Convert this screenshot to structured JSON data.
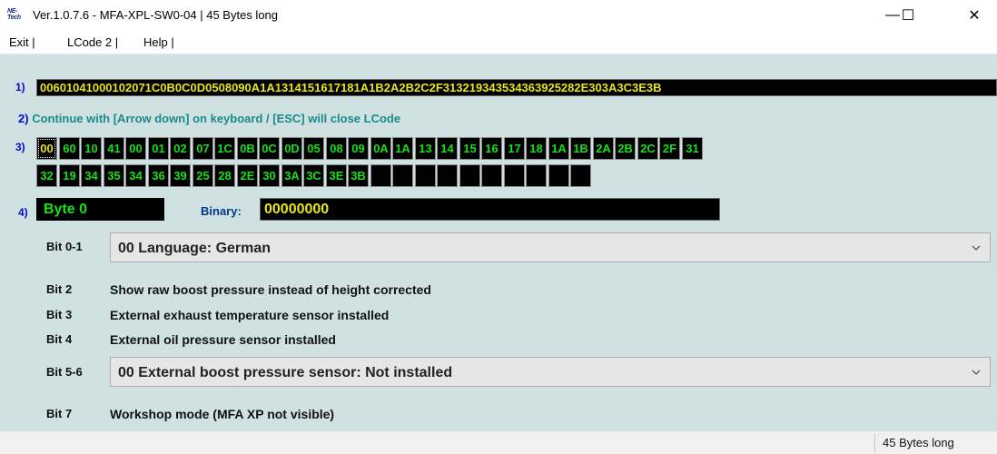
{
  "window": {
    "icon_text": [
      "NE-",
      "Tech"
    ],
    "title": "Ver.1.0.7.6 -   MFA-XPL-SW0-04 | 45 Bytes long",
    "minimize": "—",
    "maximize": "☐",
    "close": "✕"
  },
  "menu": [
    "Exit |",
    "LCode 2 |",
    "Help |"
  ],
  "section_numbers": [
    "1)",
    "2)",
    "3)",
    "4)"
  ],
  "code_string": "00601041000102071C0B0C0D0508090A1A1314151617181A1B2A2B2C2F313219343534363925282E303A3C3E3B",
  "hint": "Continue with [Arrow down] on keyboard / [ESC] will close LCode",
  "bytes_row1": [
    "00",
    "60",
    "10",
    "41",
    "00",
    "01",
    "02",
    "07",
    "1C",
    "0B",
    "0C",
    "0D",
    "05",
    "08",
    "09",
    "0A",
    "1A",
    "13",
    "14",
    "15",
    "16",
    "17",
    "18",
    "1A",
    "1B",
    "2A",
    "2B",
    "2C",
    "2F",
    "31"
  ],
  "bytes_row2": [
    "32",
    "19",
    "34",
    "35",
    "34",
    "36",
    "39",
    "25",
    "28",
    "2E",
    "30",
    "3A",
    "3C",
    "3E",
    "3B",
    "",
    "",
    "",
    "",
    "",
    "",
    "",
    "",
    "",
    ""
  ],
  "selected_byte": "Byte 0",
  "binary_label": "Binary:",
  "binary_value": "00000000",
  "bits": {
    "b01_label": "Bit 0-1",
    "b01_value": "00 Language: German",
    "b2_label": "Bit 2",
    "b2_text": "Show raw boost pressure instead of height corrected",
    "b3_label": "Bit 3",
    "b3_text": "External exhaust temperature sensor installed",
    "b4_label": "Bit 4",
    "b4_text": "External oil pressure sensor installed",
    "b56_label": "Bit 5-6",
    "b56_value": "00 External boost pressure sensor: Not installed",
    "b7_label": "Bit 7",
    "b7_text": "Workshop mode (MFA XP not visible)"
  },
  "status": "45 Bytes long",
  "colors": {
    "background": "#cfe1e1",
    "byte_text": "#16e016",
    "code_text": "#e6e61a",
    "section_number": "#0a0ad0",
    "hint_text": "#1a8a8a"
  },
  "icons": [
    "app-logo-icon",
    "minimize-icon",
    "maximize-icon",
    "close-icon",
    "chevron-down-icon"
  ]
}
